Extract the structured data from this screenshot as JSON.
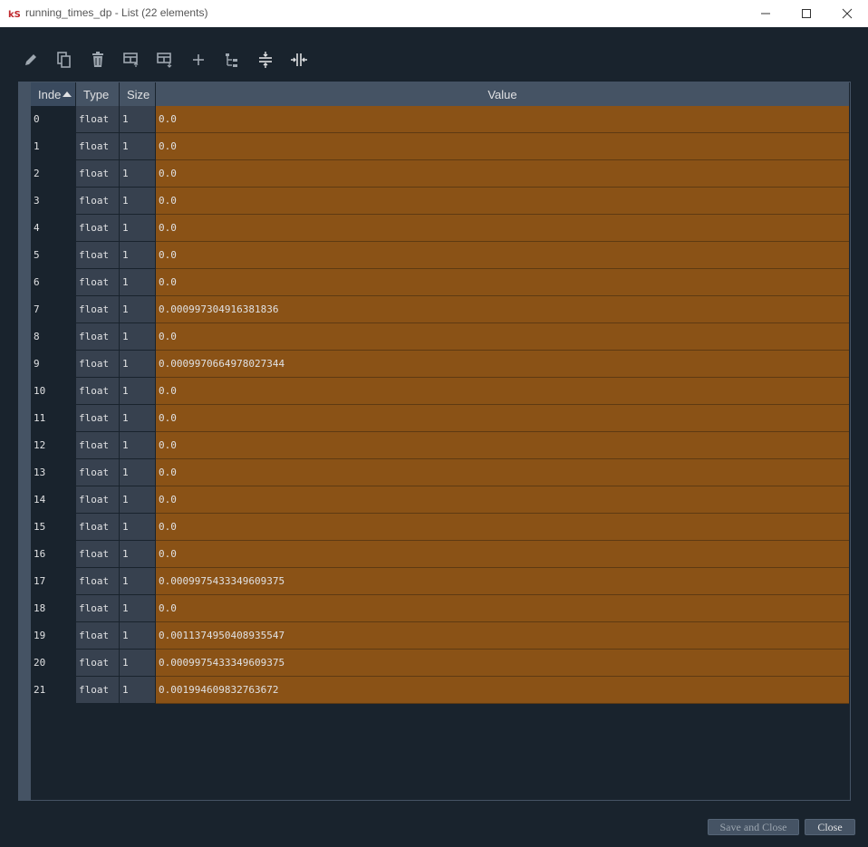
{
  "window": {
    "title": "running_times_dp - List (22 elements)"
  },
  "toolbar": {
    "icons": [
      "edit-icon",
      "copy-icon",
      "delete-icon",
      "insert-above-icon",
      "insert-below-icon",
      "add-icon",
      "tree-view-icon",
      "collapse-icon",
      "expand-icon"
    ]
  },
  "table": {
    "headers": {
      "index": "Inde",
      "type": "Type",
      "size": "Size",
      "value": "Value"
    },
    "rows": [
      {
        "index": "0",
        "type": "float",
        "size": "1",
        "value": "0.0"
      },
      {
        "index": "1",
        "type": "float",
        "size": "1",
        "value": "0.0"
      },
      {
        "index": "2",
        "type": "float",
        "size": "1",
        "value": "0.0"
      },
      {
        "index": "3",
        "type": "float",
        "size": "1",
        "value": "0.0"
      },
      {
        "index": "4",
        "type": "float",
        "size": "1",
        "value": "0.0"
      },
      {
        "index": "5",
        "type": "float",
        "size": "1",
        "value": "0.0"
      },
      {
        "index": "6",
        "type": "float",
        "size": "1",
        "value": "0.0"
      },
      {
        "index": "7",
        "type": "float",
        "size": "1",
        "value": "0.000997304916381836"
      },
      {
        "index": "8",
        "type": "float",
        "size": "1",
        "value": "0.0"
      },
      {
        "index": "9",
        "type": "float",
        "size": "1",
        "value": "0.0009970664978027344"
      },
      {
        "index": "10",
        "type": "float",
        "size": "1",
        "value": "0.0"
      },
      {
        "index": "11",
        "type": "float",
        "size": "1",
        "value": "0.0"
      },
      {
        "index": "12",
        "type": "float",
        "size": "1",
        "value": "0.0"
      },
      {
        "index": "13",
        "type": "float",
        "size": "1",
        "value": "0.0"
      },
      {
        "index": "14",
        "type": "float",
        "size": "1",
        "value": "0.0"
      },
      {
        "index": "15",
        "type": "float",
        "size": "1",
        "value": "0.0"
      },
      {
        "index": "16",
        "type": "float",
        "size": "1",
        "value": "0.0"
      },
      {
        "index": "17",
        "type": "float",
        "size": "1",
        "value": "0.0009975433349609375"
      },
      {
        "index": "18",
        "type": "float",
        "size": "1",
        "value": "0.0"
      },
      {
        "index": "19",
        "type": "float",
        "size": "1",
        "value": "0.0011374950408935547"
      },
      {
        "index": "20",
        "type": "float",
        "size": "1",
        "value": "0.0009975433349609375"
      },
      {
        "index": "21",
        "type": "float",
        "size": "1",
        "value": "0.001994609832763672"
      }
    ]
  },
  "buttons": {
    "save_and_close": "Save and Close",
    "close": "Close"
  },
  "colors": {
    "background": "#19232d",
    "value_cell": "#8a5216",
    "header": "#455364"
  }
}
